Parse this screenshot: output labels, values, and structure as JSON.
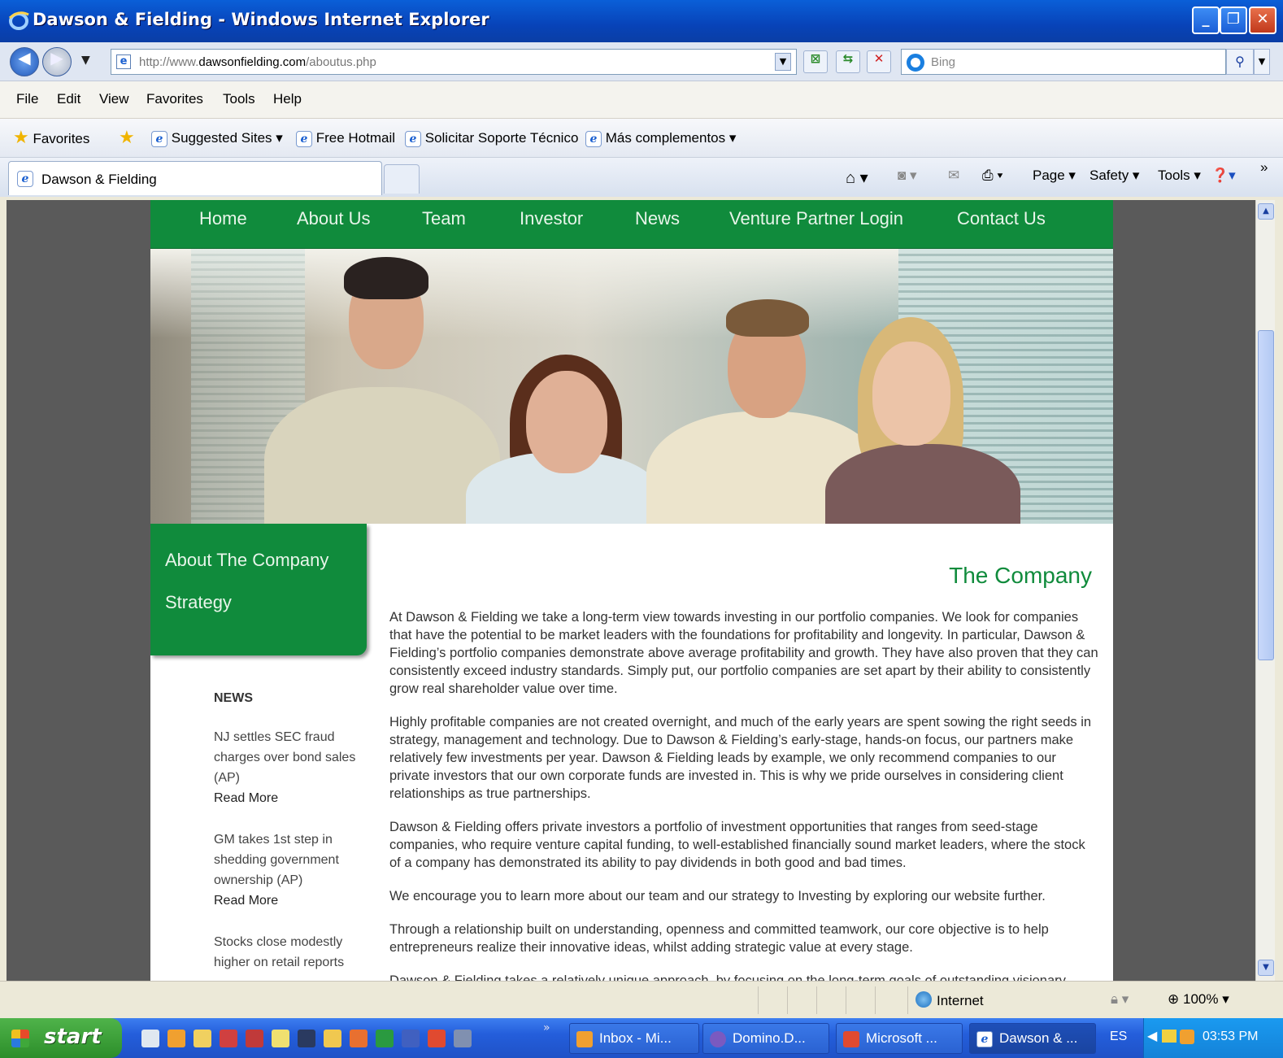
{
  "window": {
    "title": "Dawson & Fielding - Windows Internet Explorer",
    "min": "_",
    "max": "❐",
    "close": "✕"
  },
  "address": {
    "url_prefix": "http://www.",
    "url_domain": "dawsonfielding.com",
    "url_path": "/aboutus.php",
    "search_placeholder": "Bing"
  },
  "menu": [
    "File",
    "Edit",
    "View",
    "Favorites",
    "Tools",
    "Help"
  ],
  "favorites": {
    "label": "Favorites",
    "items": [
      "Suggested Sites ▾",
      "Free Hotmail",
      "Solicitar Soporte Técnico",
      "Más complementos ▾"
    ]
  },
  "tab": {
    "label": "Dawson & Fielding"
  },
  "commands": {
    "page": "Page ▾",
    "safety": "Safety ▾",
    "tools": "Tools ▾"
  },
  "site": {
    "nav": [
      "Home",
      "About Us",
      "Team",
      "Investor",
      "News",
      "Venture Partner Login",
      "Contact Us"
    ],
    "side_menu": [
      "About The Company",
      "Strategy"
    ],
    "news": {
      "heading": "NEWS",
      "items": [
        {
          "text": "NJ settles SEC fraud charges over bond sales (AP)",
          "more": "Read More"
        },
        {
          "text": "GM takes 1st step in shedding government ownership (AP)",
          "more": "Read More"
        },
        {
          "text": "Stocks close modestly higher on retail reports",
          "more": ""
        }
      ]
    },
    "heading": "The Company",
    "paragraphs": [
      "At Dawson & Fielding we take a long-term view towards investing in our portfolio companies. We look for companies that have the potential to be market leaders with the foundations for profitability and longevity. In particular, Dawson & Fielding’s portfolio companies demonstrate above average profitability and growth. They have also proven that they can consistently exceed industry standards. Simply put, our portfolio companies are set apart by their ability to consistently grow real shareholder value over time.",
      "Highly profitable companies are not created overnight, and much of the early years are spent sowing the right seeds in strategy, management and technology. Due to Dawson & Fielding’s early-stage, hands-on focus, our partners make relatively few investments per year. Dawson & Fielding leads by example, we only recommend companies to our private investors that our own corporate funds are invested in. This is why we pride ourselves in considering client relationships as true partnerships.",
      "Dawson & Fielding offers private investors a portfolio of investment opportunities that ranges from seed-stage companies, who require venture capital funding, to well-established financially sound market leaders, where the stock of a company has demonstrated its ability to pay dividends in both good and bad times.",
      "We encourage you to learn more about our team and our strategy to Investing by exploring our website further.",
      "Through a relationship built on understanding, openness and committed teamwork, our core objective is to help entrepreneurs realize their innovative ideas, whilst adding strategic value at every stage.",
      "Dawson & Fielding takes a relatively unique approach, by focusing on the long-term goals of outstanding visionary"
    ]
  },
  "status": {
    "zone": "Internet",
    "zoom": "100%"
  },
  "taskbar": {
    "start": "start",
    "tasks": [
      "Inbox - Mi...",
      "Domino.D...",
      "Microsoft ...",
      "Dawson & ..."
    ],
    "lang": "ES",
    "clock": "03:53 PM"
  },
  "colors": {
    "site_green": "#108b3c",
    "xp_blue": "#245edb"
  }
}
